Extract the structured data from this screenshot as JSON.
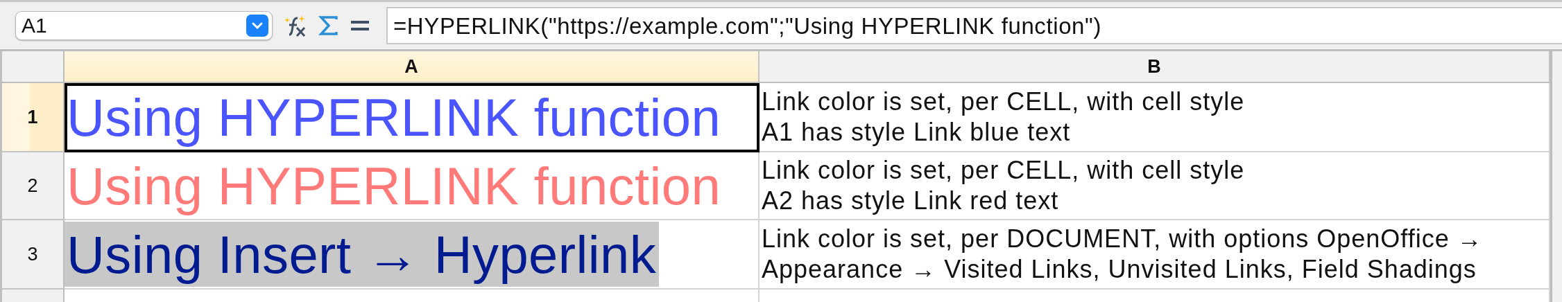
{
  "name_box": {
    "value": "A1"
  },
  "formula_bar": {
    "value": "=HYPERLINK(\"https://example.com\";\"Using HYPERLINK function\")"
  },
  "columns": [
    {
      "label": "A",
      "selected": true
    },
    {
      "label": "B",
      "selected": false
    }
  ],
  "rows": [
    {
      "label": "1",
      "selected": true,
      "cells": [
        {
          "text": "Using HYPERLINK function",
          "color": "#4a55ff",
          "shaded": false
        },
        {
          "text": "Link color is set, per CELL, with cell style\nA1 has style Link blue text"
        }
      ]
    },
    {
      "label": "2",
      "selected": false,
      "cells": [
        {
          "text": "Using HYPERLINK function",
          "color": "#ff7a78",
          "shaded": false
        },
        {
          "text": "Link color is set, per CELL, with cell style\nA2 has style Link red text"
        }
      ]
    },
    {
      "label": "3",
      "selected": false,
      "cells": [
        {
          "text": "Using Insert → Hyperlink",
          "color": "#001a8f",
          "shaded": true
        },
        {
          "text": "Link color is set, per DOCUMENT, with options OpenOffice →\nAppearance → Visited Links, Unvisited Links, Field Shadings"
        }
      ]
    }
  ]
}
